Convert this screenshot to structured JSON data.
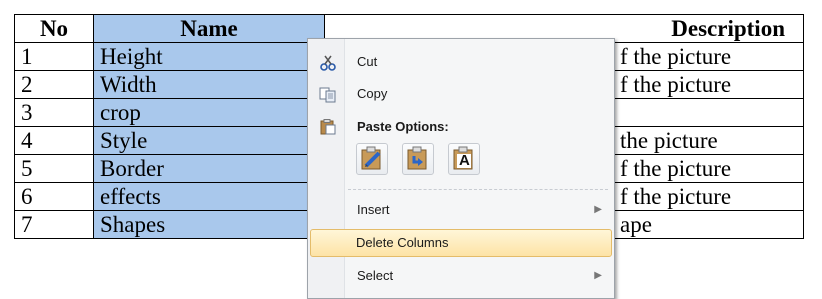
{
  "table": {
    "headers": [
      "No",
      "Name",
      "Description"
    ],
    "rows": [
      {
        "no": "1",
        "name": "Height",
        "desc": "f the picture"
      },
      {
        "no": "2",
        "name": "Width",
        "desc": "f the picture"
      },
      {
        "no": "3",
        "name": "crop",
        "desc": ""
      },
      {
        "no": "4",
        "name": "Style",
        "desc": "the picture"
      },
      {
        "no": "5",
        "name": "Border",
        "desc": "f the picture"
      },
      {
        "no": "6",
        "name": "effects",
        "desc": "f the picture"
      },
      {
        "no": "7",
        "name": "Shapes",
        "desc": "ape"
      }
    ]
  },
  "menu": {
    "cut": "Cut",
    "copy": "Copy",
    "paste_options": "Paste Options:",
    "paste_keep_text": "A",
    "insert": "Insert",
    "delete_columns": "Delete Columns",
    "select": "Select"
  },
  "colors": {
    "selection": "#a9c8ec",
    "hover_border": "#e4bc6a"
  },
  "icons": [
    "scissors-icon",
    "copy-icon",
    "clipboard-icon",
    "paste-keep-formatting-icon",
    "paste-merge-formatting-icon",
    "paste-text-only-icon"
  ]
}
